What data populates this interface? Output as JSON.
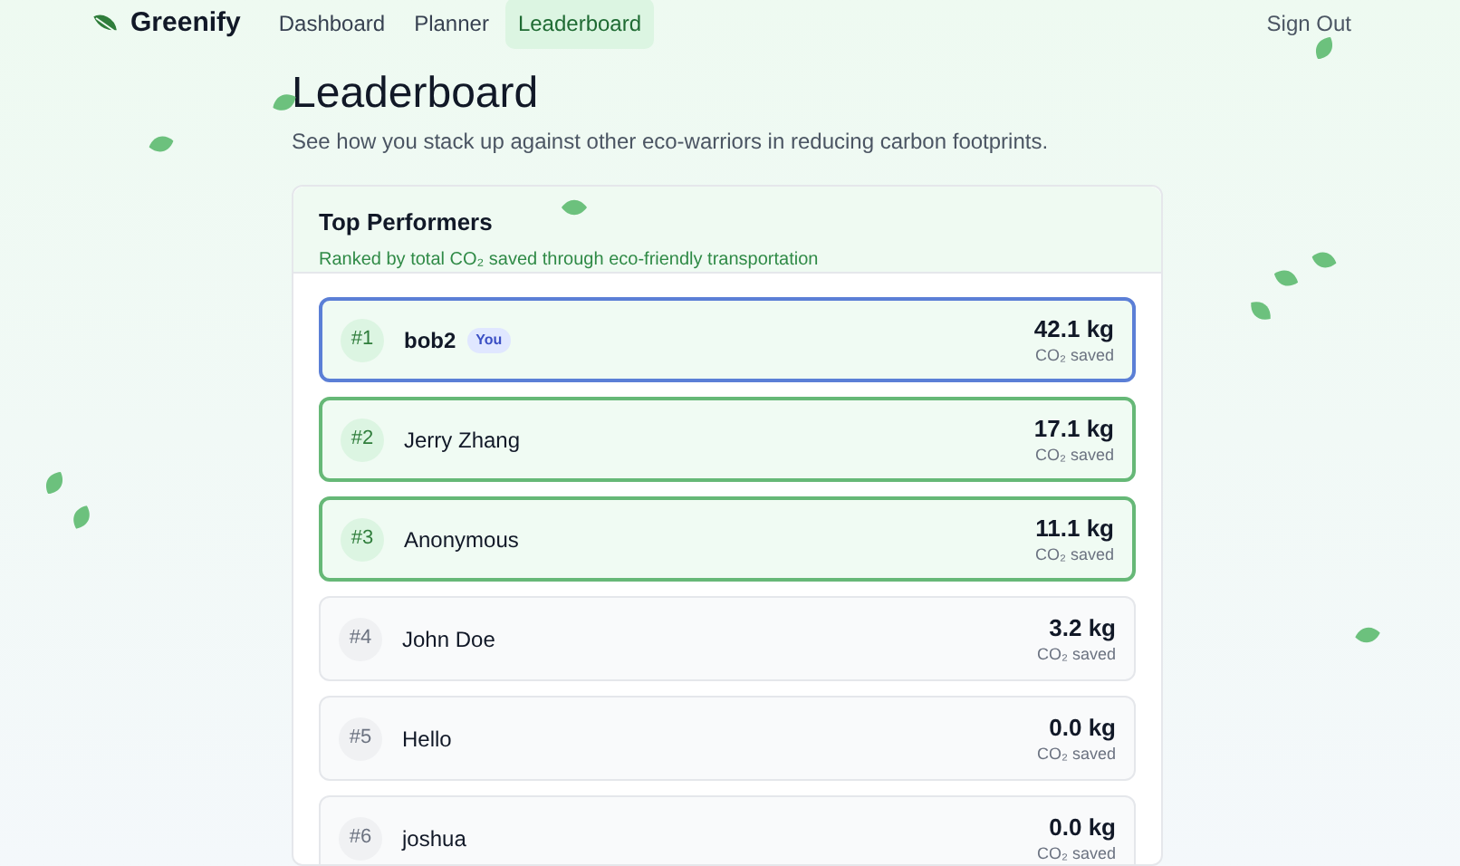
{
  "nav": {
    "brand": "Greenify",
    "links": [
      {
        "label": "Dashboard",
        "selected": false
      },
      {
        "label": "Planner",
        "selected": false
      },
      {
        "label": "Leaderboard",
        "selected": true
      }
    ],
    "sign_out": "Sign Out"
  },
  "heading": "Leaderboard",
  "intro": "See how you stack up against other eco-warriors in reducing carbon footprints.",
  "card": {
    "title": "Top Performers",
    "subtitle": "Ranked by total CO₂ saved through eco-friendly transportation",
    "rows": [
      {
        "rank": "#1",
        "name": "bob2",
        "badge": "You",
        "current_user": true,
        "top": true,
        "amount": "42.1 kg",
        "unit": "CO₂ saved"
      },
      {
        "rank": "#2",
        "name": "Jerry Zhang",
        "current_user": false,
        "top": true,
        "amount": "17.1 kg",
        "unit": "CO₂ saved"
      },
      {
        "rank": "#3",
        "name": "Anonymous",
        "current_user": false,
        "top": true,
        "amount": "11.1 kg",
        "unit": "CO₂ saved"
      },
      {
        "rank": "#4",
        "name": "John Doe",
        "current_user": false,
        "top": false,
        "amount": "3.2 kg",
        "unit": "CO₂ saved"
      },
      {
        "rank": "#5",
        "name": "Hello",
        "current_user": false,
        "top": false,
        "amount": "0.0 kg",
        "unit": "CO₂ saved"
      },
      {
        "rank": "#6",
        "name": "joshua",
        "current_user": false,
        "top": false,
        "amount": "0.0 kg",
        "unit": "CO₂ saved"
      }
    ]
  }
}
